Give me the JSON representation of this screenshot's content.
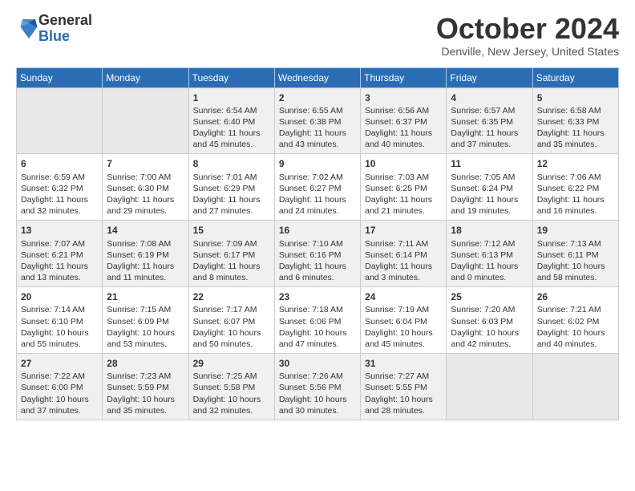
{
  "logo": {
    "general": "General",
    "blue": "Blue"
  },
  "title": "October 2024",
  "subtitle": "Denville, New Jersey, United States",
  "days": [
    "Sunday",
    "Monday",
    "Tuesday",
    "Wednesday",
    "Thursday",
    "Friday",
    "Saturday"
  ],
  "weeks": [
    [
      {
        "day": "",
        "empty": true
      },
      {
        "day": "",
        "empty": true
      },
      {
        "day": "1",
        "sunrise": "Sunrise: 6:54 AM",
        "sunset": "Sunset: 6:40 PM",
        "daylight": "Daylight: 11 hours and 45 minutes."
      },
      {
        "day": "2",
        "sunrise": "Sunrise: 6:55 AM",
        "sunset": "Sunset: 6:38 PM",
        "daylight": "Daylight: 11 hours and 43 minutes."
      },
      {
        "day": "3",
        "sunrise": "Sunrise: 6:56 AM",
        "sunset": "Sunset: 6:37 PM",
        "daylight": "Daylight: 11 hours and 40 minutes."
      },
      {
        "day": "4",
        "sunrise": "Sunrise: 6:57 AM",
        "sunset": "Sunset: 6:35 PM",
        "daylight": "Daylight: 11 hours and 37 minutes."
      },
      {
        "day": "5",
        "sunrise": "Sunrise: 6:58 AM",
        "sunset": "Sunset: 6:33 PM",
        "daylight": "Daylight: 11 hours and 35 minutes."
      }
    ],
    [
      {
        "day": "6",
        "sunrise": "Sunrise: 6:59 AM",
        "sunset": "Sunset: 6:32 PM",
        "daylight": "Daylight: 11 hours and 32 minutes."
      },
      {
        "day": "7",
        "sunrise": "Sunrise: 7:00 AM",
        "sunset": "Sunset: 6:30 PM",
        "daylight": "Daylight: 11 hours and 29 minutes."
      },
      {
        "day": "8",
        "sunrise": "Sunrise: 7:01 AM",
        "sunset": "Sunset: 6:29 PM",
        "daylight": "Daylight: 11 hours and 27 minutes."
      },
      {
        "day": "9",
        "sunrise": "Sunrise: 7:02 AM",
        "sunset": "Sunset: 6:27 PM",
        "daylight": "Daylight: 11 hours and 24 minutes."
      },
      {
        "day": "10",
        "sunrise": "Sunrise: 7:03 AM",
        "sunset": "Sunset: 6:25 PM",
        "daylight": "Daylight: 11 hours and 21 minutes."
      },
      {
        "day": "11",
        "sunrise": "Sunrise: 7:05 AM",
        "sunset": "Sunset: 6:24 PM",
        "daylight": "Daylight: 11 hours and 19 minutes."
      },
      {
        "day": "12",
        "sunrise": "Sunrise: 7:06 AM",
        "sunset": "Sunset: 6:22 PM",
        "daylight": "Daylight: 11 hours and 16 minutes."
      }
    ],
    [
      {
        "day": "13",
        "sunrise": "Sunrise: 7:07 AM",
        "sunset": "Sunset: 6:21 PM",
        "daylight": "Daylight: 11 hours and 13 minutes."
      },
      {
        "day": "14",
        "sunrise": "Sunrise: 7:08 AM",
        "sunset": "Sunset: 6:19 PM",
        "daylight": "Daylight: 11 hours and 11 minutes."
      },
      {
        "day": "15",
        "sunrise": "Sunrise: 7:09 AM",
        "sunset": "Sunset: 6:17 PM",
        "daylight": "Daylight: 11 hours and 8 minutes."
      },
      {
        "day": "16",
        "sunrise": "Sunrise: 7:10 AM",
        "sunset": "Sunset: 6:16 PM",
        "daylight": "Daylight: 11 hours and 6 minutes."
      },
      {
        "day": "17",
        "sunrise": "Sunrise: 7:11 AM",
        "sunset": "Sunset: 6:14 PM",
        "daylight": "Daylight: 11 hours and 3 minutes."
      },
      {
        "day": "18",
        "sunrise": "Sunrise: 7:12 AM",
        "sunset": "Sunset: 6:13 PM",
        "daylight": "Daylight: 11 hours and 0 minutes."
      },
      {
        "day": "19",
        "sunrise": "Sunrise: 7:13 AM",
        "sunset": "Sunset: 6:11 PM",
        "daylight": "Daylight: 10 hours and 58 minutes."
      }
    ],
    [
      {
        "day": "20",
        "sunrise": "Sunrise: 7:14 AM",
        "sunset": "Sunset: 6:10 PM",
        "daylight": "Daylight: 10 hours and 55 minutes."
      },
      {
        "day": "21",
        "sunrise": "Sunrise: 7:15 AM",
        "sunset": "Sunset: 6:09 PM",
        "daylight": "Daylight: 10 hours and 53 minutes."
      },
      {
        "day": "22",
        "sunrise": "Sunrise: 7:17 AM",
        "sunset": "Sunset: 6:07 PM",
        "daylight": "Daylight: 10 hours and 50 minutes."
      },
      {
        "day": "23",
        "sunrise": "Sunrise: 7:18 AM",
        "sunset": "Sunset: 6:06 PM",
        "daylight": "Daylight: 10 hours and 47 minutes."
      },
      {
        "day": "24",
        "sunrise": "Sunrise: 7:19 AM",
        "sunset": "Sunset: 6:04 PM",
        "daylight": "Daylight: 10 hours and 45 minutes."
      },
      {
        "day": "25",
        "sunrise": "Sunrise: 7:20 AM",
        "sunset": "Sunset: 6:03 PM",
        "daylight": "Daylight: 10 hours and 42 minutes."
      },
      {
        "day": "26",
        "sunrise": "Sunrise: 7:21 AM",
        "sunset": "Sunset: 6:02 PM",
        "daylight": "Daylight: 10 hours and 40 minutes."
      }
    ],
    [
      {
        "day": "27",
        "sunrise": "Sunrise: 7:22 AM",
        "sunset": "Sunset: 6:00 PM",
        "daylight": "Daylight: 10 hours and 37 minutes."
      },
      {
        "day": "28",
        "sunrise": "Sunrise: 7:23 AM",
        "sunset": "Sunset: 5:59 PM",
        "daylight": "Daylight: 10 hours and 35 minutes."
      },
      {
        "day": "29",
        "sunrise": "Sunrise: 7:25 AM",
        "sunset": "Sunset: 5:58 PM",
        "daylight": "Daylight: 10 hours and 32 minutes."
      },
      {
        "day": "30",
        "sunrise": "Sunrise: 7:26 AM",
        "sunset": "Sunset: 5:56 PM",
        "daylight": "Daylight: 10 hours and 30 minutes."
      },
      {
        "day": "31",
        "sunrise": "Sunrise: 7:27 AM",
        "sunset": "Sunset: 5:55 PM",
        "daylight": "Daylight: 10 hours and 28 minutes."
      },
      {
        "day": "",
        "empty": true
      },
      {
        "day": "",
        "empty": true
      }
    ]
  ]
}
